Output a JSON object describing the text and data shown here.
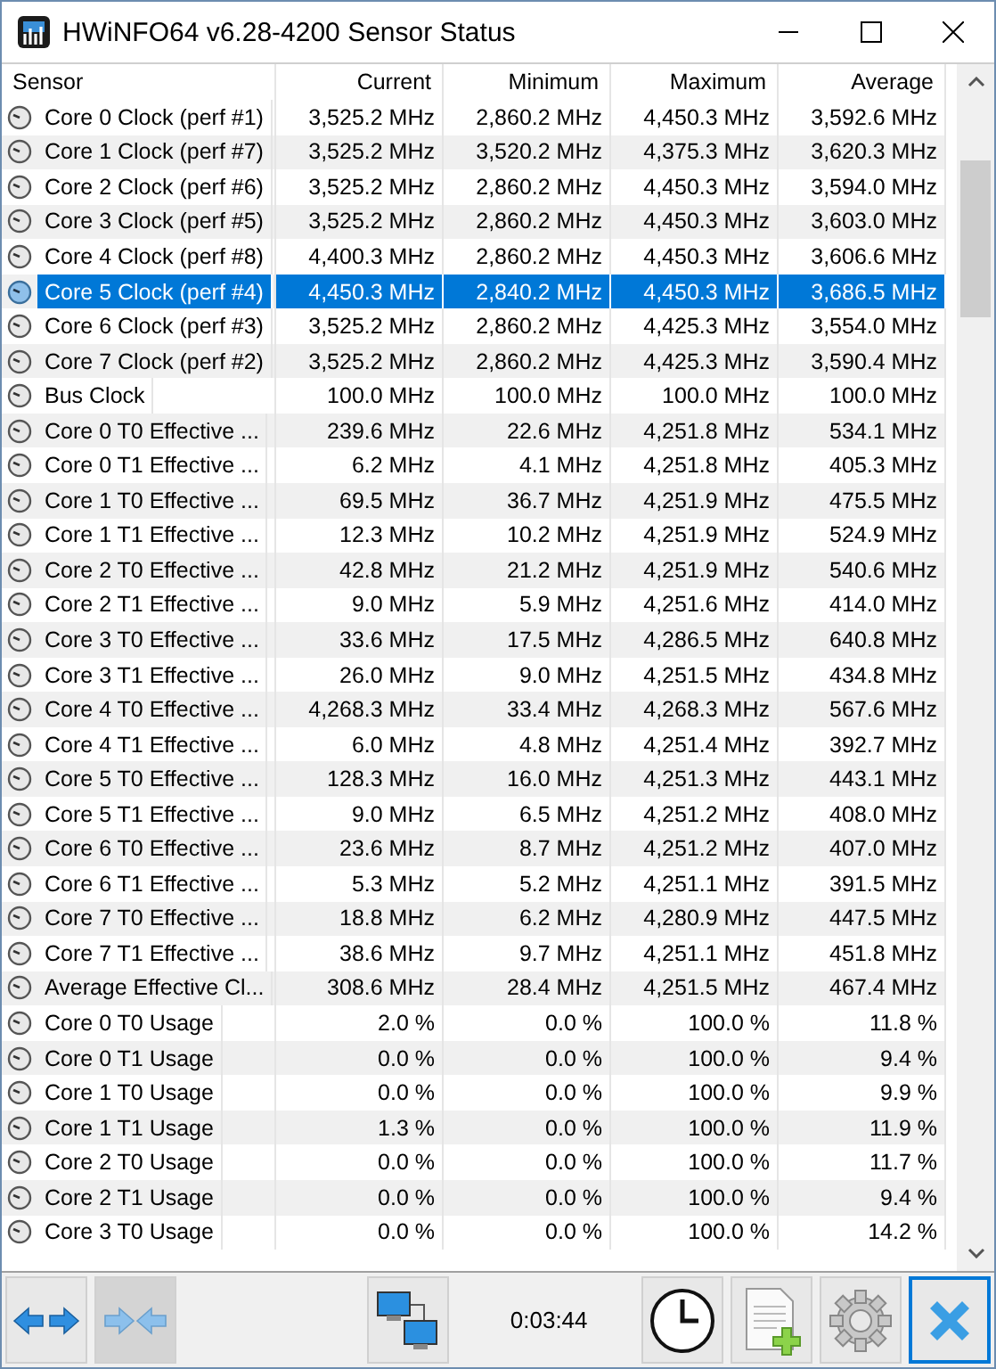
{
  "window": {
    "title": "HWiNFO64 v6.28-4200 Sensor Status"
  },
  "table": {
    "columns": [
      "Sensor",
      "Current",
      "Minimum",
      "Maximum",
      "Average"
    ],
    "rows": [
      {
        "sensor": "Core 0 Clock (perf #1)",
        "current": "3,525.2 MHz",
        "minimum": "2,860.2 MHz",
        "maximum": "4,450.3 MHz",
        "average": "3,592.6 MHz",
        "selected": false
      },
      {
        "sensor": "Core 1 Clock (perf #7)",
        "current": "3,525.2 MHz",
        "minimum": "3,520.2 MHz",
        "maximum": "4,375.3 MHz",
        "average": "3,620.3 MHz",
        "selected": false
      },
      {
        "sensor": "Core 2 Clock (perf #6)",
        "current": "3,525.2 MHz",
        "minimum": "2,860.2 MHz",
        "maximum": "4,450.3 MHz",
        "average": "3,594.0 MHz",
        "selected": false
      },
      {
        "sensor": "Core 3 Clock (perf #5)",
        "current": "3,525.2 MHz",
        "minimum": "2,860.2 MHz",
        "maximum": "4,450.3 MHz",
        "average": "3,603.0 MHz",
        "selected": false
      },
      {
        "sensor": "Core 4 Clock (perf #8)",
        "current": "4,400.3 MHz",
        "minimum": "2,860.2 MHz",
        "maximum": "4,450.3 MHz",
        "average": "3,606.6 MHz",
        "selected": false
      },
      {
        "sensor": "Core 5 Clock (perf #4)",
        "current": "4,450.3 MHz",
        "minimum": "2,840.2 MHz",
        "maximum": "4,450.3 MHz",
        "average": "3,686.5 MHz",
        "selected": true
      },
      {
        "sensor": "Core 6 Clock (perf #3)",
        "current": "3,525.2 MHz",
        "minimum": "2,860.2 MHz",
        "maximum": "4,425.3 MHz",
        "average": "3,554.0 MHz",
        "selected": false
      },
      {
        "sensor": "Core 7 Clock (perf #2)",
        "current": "3,525.2 MHz",
        "minimum": "2,860.2 MHz",
        "maximum": "4,425.3 MHz",
        "average": "3,590.4 MHz",
        "selected": false
      },
      {
        "sensor": "Bus Clock",
        "current": "100.0 MHz",
        "minimum": "100.0 MHz",
        "maximum": "100.0 MHz",
        "average": "100.0 MHz",
        "selected": false
      },
      {
        "sensor": "Core 0 T0 Effective ...",
        "current": "239.6 MHz",
        "minimum": "22.6 MHz",
        "maximum": "4,251.8 MHz",
        "average": "534.1 MHz",
        "selected": false
      },
      {
        "sensor": "Core 0 T1 Effective ...",
        "current": "6.2 MHz",
        "minimum": "4.1 MHz",
        "maximum": "4,251.8 MHz",
        "average": "405.3 MHz",
        "selected": false
      },
      {
        "sensor": "Core 1 T0 Effective ...",
        "current": "69.5 MHz",
        "minimum": "36.7 MHz",
        "maximum": "4,251.9 MHz",
        "average": "475.5 MHz",
        "selected": false
      },
      {
        "sensor": "Core 1 T1 Effective ...",
        "current": "12.3 MHz",
        "minimum": "10.2 MHz",
        "maximum": "4,251.9 MHz",
        "average": "524.9 MHz",
        "selected": false
      },
      {
        "sensor": "Core 2 T0 Effective ...",
        "current": "42.8 MHz",
        "minimum": "21.2 MHz",
        "maximum": "4,251.9 MHz",
        "average": "540.6 MHz",
        "selected": false
      },
      {
        "sensor": "Core 2 T1 Effective ...",
        "current": "9.0 MHz",
        "minimum": "5.9 MHz",
        "maximum": "4,251.6 MHz",
        "average": "414.0 MHz",
        "selected": false
      },
      {
        "sensor": "Core 3 T0 Effective ...",
        "current": "33.6 MHz",
        "minimum": "17.5 MHz",
        "maximum": "4,286.5 MHz",
        "average": "640.8 MHz",
        "selected": false
      },
      {
        "sensor": "Core 3 T1 Effective ...",
        "current": "26.0 MHz",
        "minimum": "9.0 MHz",
        "maximum": "4,251.5 MHz",
        "average": "434.8 MHz",
        "selected": false
      },
      {
        "sensor": "Core 4 T0 Effective ...",
        "current": "4,268.3 MHz",
        "minimum": "33.4 MHz",
        "maximum": "4,268.3 MHz",
        "average": "567.6 MHz",
        "selected": false
      },
      {
        "sensor": "Core 4 T1 Effective ...",
        "current": "6.0 MHz",
        "minimum": "4.8 MHz",
        "maximum": "4,251.4 MHz",
        "average": "392.7 MHz",
        "selected": false
      },
      {
        "sensor": "Core 5 T0 Effective ...",
        "current": "128.3 MHz",
        "minimum": "16.0 MHz",
        "maximum": "4,251.3 MHz",
        "average": "443.1 MHz",
        "selected": false
      },
      {
        "sensor": "Core 5 T1 Effective ...",
        "current": "9.0 MHz",
        "minimum": "6.5 MHz",
        "maximum": "4,251.2 MHz",
        "average": "408.0 MHz",
        "selected": false
      },
      {
        "sensor": "Core 6 T0 Effective ...",
        "current": "23.6 MHz",
        "minimum": "8.7 MHz",
        "maximum": "4,251.2 MHz",
        "average": "407.0 MHz",
        "selected": false
      },
      {
        "sensor": "Core 6 T1 Effective ...",
        "current": "5.3 MHz",
        "minimum": "5.2 MHz",
        "maximum": "4,251.1 MHz",
        "average": "391.5 MHz",
        "selected": false
      },
      {
        "sensor": "Core 7 T0 Effective ...",
        "current": "18.8 MHz",
        "minimum": "6.2 MHz",
        "maximum": "4,280.9 MHz",
        "average": "447.5 MHz",
        "selected": false
      },
      {
        "sensor": "Core 7 T1 Effective ...",
        "current": "38.6 MHz",
        "minimum": "9.7 MHz",
        "maximum": "4,251.1 MHz",
        "average": "451.8 MHz",
        "selected": false
      },
      {
        "sensor": "Average Effective Cl...",
        "current": "308.6 MHz",
        "minimum": "28.4 MHz",
        "maximum": "4,251.5 MHz",
        "average": "467.4 MHz",
        "selected": false
      },
      {
        "sensor": "Core 0 T0 Usage",
        "current": "2.0 %",
        "minimum": "0.0 %",
        "maximum": "100.0 %",
        "average": "11.8 %",
        "selected": false
      },
      {
        "sensor": "Core 0 T1 Usage",
        "current": "0.0 %",
        "minimum": "0.0 %",
        "maximum": "100.0 %",
        "average": "9.4 %",
        "selected": false
      },
      {
        "sensor": "Core 1 T0 Usage",
        "current": "0.0 %",
        "minimum": "0.0 %",
        "maximum": "100.0 %",
        "average": "9.9 %",
        "selected": false
      },
      {
        "sensor": "Core 1 T1 Usage",
        "current": "1.3 %",
        "minimum": "0.0 %",
        "maximum": "100.0 %",
        "average": "11.9 %",
        "selected": false
      },
      {
        "sensor": "Core 2 T0 Usage",
        "current": "0.0 %",
        "minimum": "0.0 %",
        "maximum": "100.0 %",
        "average": "11.7 %",
        "selected": false
      },
      {
        "sensor": "Core 2 T1 Usage",
        "current": "0.0 %",
        "minimum": "0.0 %",
        "maximum": "100.0 %",
        "average": "9.4 %",
        "selected": false
      },
      {
        "sensor": "Core 3 T0 Usage",
        "current": "0.0 %",
        "minimum": "0.0 %",
        "maximum": "100.0 %",
        "average": "14.2 %",
        "selected": false
      }
    ]
  },
  "toolbar": {
    "buttons": [
      {
        "kind": "expand",
        "pressed": false
      },
      {
        "kind": "collapse",
        "pressed": true
      },
      {
        "kind": "network",
        "pressed": false
      },
      {
        "kind": "timer",
        "text": "0:03:44"
      },
      {
        "kind": "clock",
        "pressed": false
      },
      {
        "kind": "report",
        "pressed": false
      },
      {
        "kind": "settings",
        "pressed": false
      },
      {
        "kind": "close",
        "pressed": false
      }
    ]
  }
}
